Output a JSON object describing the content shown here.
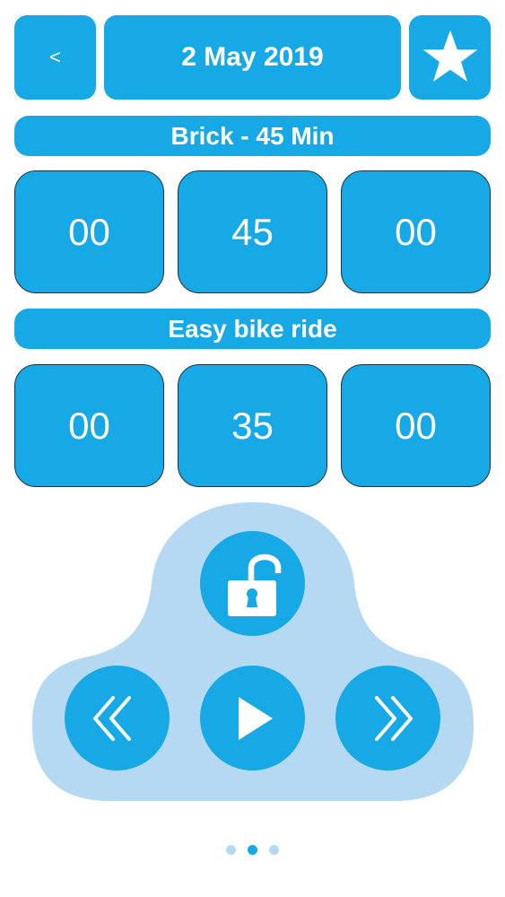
{
  "header": {
    "back_label": "<",
    "date": "2 May 2019",
    "favorite_icon": "star-icon"
  },
  "workout": {
    "title": "Brick - 45 Min",
    "time": {
      "hours": "00",
      "minutes": "45",
      "seconds": "00"
    }
  },
  "step": {
    "title": "Easy bike ride",
    "time": {
      "hours": "00",
      "minutes": "35",
      "seconds": "00"
    }
  },
  "controls": {
    "lock_icon": "unlocked-padlock-icon",
    "rewind_icon": "double-chevron-left-icon",
    "play_icon": "play-icon",
    "forward_icon": "double-chevron-right-icon"
  },
  "pager": {
    "count": 3,
    "active_index": 1
  },
  "colors": {
    "accent": "#17a8e6",
    "pad": "#b5d9f2",
    "border": "#1c3442"
  }
}
